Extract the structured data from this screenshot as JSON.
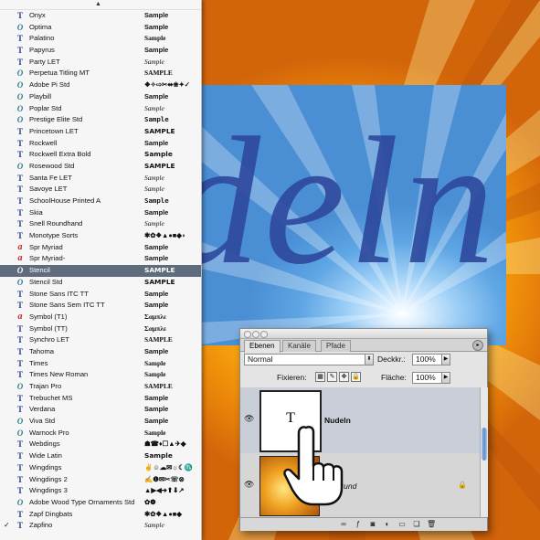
{
  "fonts": [
    {
      "name": "Onyx",
      "icon": "truetype-icon",
      "sample": "Sample"
    },
    {
      "name": "Optima",
      "icon": "opentype-icon",
      "sample": "Sample"
    },
    {
      "name": "Palatino",
      "icon": "truetype-icon",
      "sample": "Sample"
    },
    {
      "name": "Papyrus",
      "icon": "truetype-icon",
      "sample": "Sample"
    },
    {
      "name": "Party LET",
      "icon": "truetype-icon",
      "sample": "Sample"
    },
    {
      "name": "Perpetua Titling MT",
      "icon": "opentype-icon",
      "sample": "SAMPLE"
    },
    {
      "name": "Adobe Pi Std",
      "icon": "opentype-icon",
      "sample": "❖✧⇨✂⬌❀✦✓"
    },
    {
      "name": "Playbill",
      "icon": "opentype-icon",
      "sample": "Sample"
    },
    {
      "name": "Poplar Std",
      "icon": "opentype-icon",
      "sample": "Sample"
    },
    {
      "name": "Prestige Elite Std",
      "icon": "opentype-icon",
      "sample": "Sample"
    },
    {
      "name": "Princetown LET",
      "icon": "truetype-icon",
      "sample": "SAMPLE"
    },
    {
      "name": "Rockwell",
      "icon": "truetype-icon",
      "sample": "Sample"
    },
    {
      "name": "Rockwell Extra Bold",
      "icon": "truetype-icon",
      "sample": "Sample"
    },
    {
      "name": "Rosewood Std",
      "icon": "opentype-icon",
      "sample": "SAMPLE"
    },
    {
      "name": "Santa Fe LET",
      "icon": "truetype-icon",
      "sample": "Sample"
    },
    {
      "name": "Savoye LET",
      "icon": "truetype-icon",
      "sample": "Sample"
    },
    {
      "name": "SchoolHouse Printed A",
      "icon": "truetype-icon",
      "sample": "Sample"
    },
    {
      "name": "Skia",
      "icon": "truetype-icon",
      "sample": "Sample"
    },
    {
      "name": "Snell Roundhand",
      "icon": "truetype-icon",
      "sample": "Sample"
    },
    {
      "name": "Monotype Sorts",
      "icon": "truetype-icon",
      "sample": "✱✿❖▲●■◆◗"
    },
    {
      "name": "Spr Myriad",
      "icon": "adobe-icon",
      "sample": "Sample"
    },
    {
      "name": "Spr Myriad-",
      "icon": "adobe-icon",
      "sample": "Sample"
    },
    {
      "name": "Stencil",
      "icon": "opentype-icon",
      "sample": "SAMPLE",
      "selected": true
    },
    {
      "name": "Stencil Std",
      "icon": "opentype-icon",
      "sample": "SAMPLE"
    },
    {
      "name": "Stone Sans ITC TT",
      "icon": "truetype-icon",
      "sample": "Sample"
    },
    {
      "name": "Stone Sans Sem ITC TT",
      "icon": "truetype-icon",
      "sample": "Sample"
    },
    {
      "name": "Symbol (T1)",
      "icon": "adobe-icon",
      "sample": "Σαμπλε"
    },
    {
      "name": "Symbol (TT)",
      "icon": "truetype-icon",
      "sample": "Σαμπλε"
    },
    {
      "name": "Synchro LET",
      "icon": "truetype-icon",
      "sample": "SAMPLE"
    },
    {
      "name": "Tahoma",
      "icon": "truetype-icon",
      "sample": "Sample"
    },
    {
      "name": "Times",
      "icon": "truetype-icon",
      "sample": "Sample"
    },
    {
      "name": "Times New Roman",
      "icon": "truetype-icon",
      "sample": "Sample"
    },
    {
      "name": "Trajan Pro",
      "icon": "opentype-icon",
      "sample": "SAMPLE"
    },
    {
      "name": "Trebuchet MS",
      "icon": "truetype-icon",
      "sample": "Sample"
    },
    {
      "name": "Verdana",
      "icon": "truetype-icon",
      "sample": "Sample"
    },
    {
      "name": "Viva Std",
      "icon": "opentype-icon",
      "sample": "Sample"
    },
    {
      "name": "Warnock Pro",
      "icon": "opentype-icon",
      "sample": "Sample"
    },
    {
      "name": "Webdings",
      "icon": "truetype-icon",
      "sample": "☗☎♦☐▲✈◆"
    },
    {
      "name": "Wide Latin",
      "icon": "truetype-icon",
      "sample": "Sample"
    },
    {
      "name": "Wingdings",
      "icon": "truetype-icon",
      "sample": "✌☺☁✉☼☾♏"
    },
    {
      "name": "Wingdings 2",
      "icon": "truetype-icon",
      "sample": "✍❶✉✂☏⊗"
    },
    {
      "name": "Wingdings 3",
      "icon": "truetype-icon",
      "sample": "▲▶◀➔⬆⬇↗"
    },
    {
      "name": "Adobe Wood Type Ornaments Std",
      "icon": "opentype-icon",
      "sample": "✿❁"
    },
    {
      "name": "Zapf Dingbats",
      "icon": "truetype-icon",
      "sample": "✱✿❖▲●■◆"
    },
    {
      "name": "Zapfino",
      "icon": "truetype-icon",
      "sample": "Sample",
      "checked": true
    }
  ],
  "canvas_text": "deln",
  "layers_panel": {
    "tabs": [
      "Ebenen",
      "Kanäle",
      "Pfade"
    ],
    "blend_mode": "Normal",
    "opacity_label": "Deckkr.:",
    "opacity_value": "100%",
    "lock_label": "Fixieren:",
    "fill_label": "Fläche:",
    "fill_value": "100%",
    "layers": [
      {
        "name": "Nudeln",
        "thumb_text": "T",
        "selected": true
      },
      {
        "name": "ergrund",
        "locked": true
      }
    ]
  },
  "colors": {
    "menu_selection": "#5e6c7d",
    "truetype_icon": "#27408b",
    "opentype_icon": "#2e7d8a",
    "adobe_icon": "#c0282d",
    "canvas_text": "#2f4a9e"
  }
}
